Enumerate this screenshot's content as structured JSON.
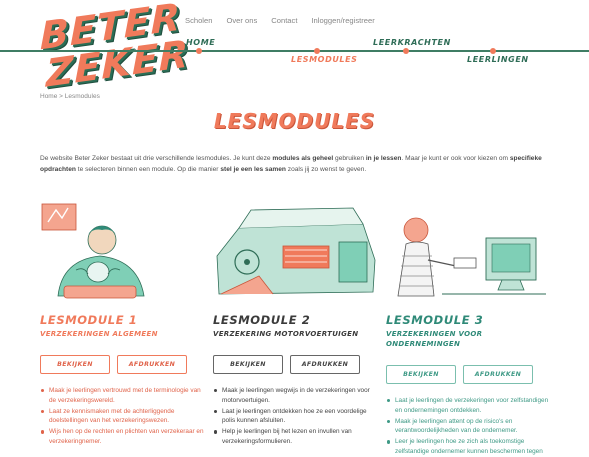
{
  "brand": {
    "line1": "BETER",
    "line2": "ZEKER"
  },
  "topnav": [
    {
      "label": "Scholen"
    },
    {
      "label": "Over ons"
    },
    {
      "label": "Contact"
    },
    {
      "label": "Inloggen/registreer"
    }
  ],
  "mainnav": {
    "home": "HOME",
    "lesmodules": "LESMODULES",
    "leerkrachten": "LEERKRACHTEN",
    "leerlingen": "LEERLINGEN"
  },
  "breadcrumb": {
    "home": "Home",
    "sep": " > ",
    "current": "Lesmodules"
  },
  "page": {
    "title": "LESMODULES",
    "intro": {
      "t1": "De website Beter Zeker bestaat uit drie verschillende lesmodules. Je kunt deze ",
      "b1": "modules als geheel",
      "t2": " gebruiken ",
      "b2": "in je lessen",
      "t3": ". Maar je kunt er ook voor kiezen om ",
      "b3": "specifieke opdrachten",
      "t4": " te selecteren binnen een module. Op die manier ",
      "b4": "stel je een les samen",
      "t5": " zoals jij zo wenst te geven."
    }
  },
  "modules": [
    {
      "title": "LESMODULE 1",
      "subtitle": "VERZEKERINGEN ALGEMEEN",
      "view_label": "BEKIJKEN",
      "print_label": "AFDRUKKEN",
      "bullets": [
        "Maak je leerlingen vertrouwd met de terminologie van de verzekeringswereld.",
        "Laat ze kennismaken met de achterliggende doelstellingen van het verzekeringswezen.",
        "Wijs hen op de rechten en plichten van verzekeraar en verzekeringnemer."
      ],
      "colors": {
        "accent": "#f07a5b"
      }
    },
    {
      "title": "LESMODULE 2",
      "subtitle": "VERZEKERING MOTORVOERTUIGEN",
      "view_label": "BEKIJKEN",
      "print_label": "AFDRUKKEN",
      "bullets": [
        "Maak je leerlingen wegwijs in de verzekeringen voor motorvoertuigen.",
        "Laat je leerlingen ontdekken hoe ze een voordelige polis kunnen afsluiten.",
        "Help je leerlingen bij het lezen en invullen van verzekeringsformulieren."
      ],
      "colors": {
        "accent": "#3b3b3b"
      }
    },
    {
      "title": "LESMODULE 3",
      "subtitle": "VERZEKERINGEN VOOR ONDERNEMINGEN",
      "view_label": "BEKIJKEN",
      "print_label": "AFDRUKKEN",
      "bullets": [
        "Laat je leerlingen de verzekeringen voor zelfstandigen en ondernemingen ontdekken.",
        "Maak je leerlingen attent op de risico's en verantwoordelijkheden van de ondernemer.",
        "Leer je leerlingen hoe ze zich als toekomstige zelfstandige ondernemer kunnen beschermen tegen onvoorziene"
      ],
      "colors": {
        "accent": "#2f8a78"
      }
    }
  ],
  "colors": {
    "orange": "#f07a5b",
    "green": "#2f6d57",
    "teal": "#3f9a86"
  }
}
